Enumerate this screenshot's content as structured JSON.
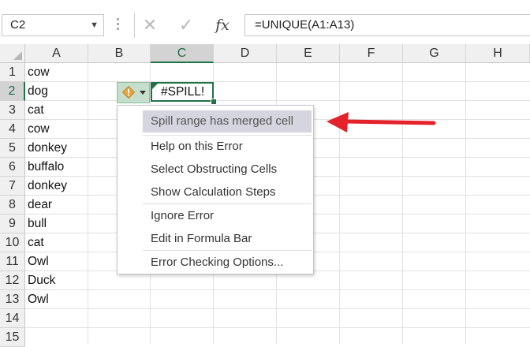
{
  "formula_bar": {
    "name_box": "C2",
    "cancel_glyph": "✕",
    "enter_glyph": "✓",
    "fx_label": "fx",
    "formula": "=UNIQUE(A1:A13)"
  },
  "columns": [
    "A",
    "B",
    "C",
    "D",
    "E",
    "F",
    "G",
    "H"
  ],
  "rows": [
    "1",
    "2",
    "3",
    "4",
    "5",
    "6",
    "7",
    "8",
    "9",
    "10",
    "11",
    "12",
    "13",
    "14",
    "15"
  ],
  "cells_a": [
    "cow",
    "dog",
    "cat",
    "cow",
    "donkey",
    "buffalo",
    "donkey",
    "dear",
    "bull",
    "cat",
    "Owl",
    "Duck",
    "Owl"
  ],
  "active_cell": {
    "ref": "C2",
    "value": "#SPILL!"
  },
  "error_button": {
    "icon": "warning-diamond-icon",
    "accent": "#e8a33a"
  },
  "menu": {
    "title": "Spill range has merged cell",
    "items": [
      "Help on this Error",
      "Select Obstructing Cells",
      "Show Calculation Steps",
      "Ignore Error",
      "Edit in Formula Bar",
      "Error Checking Options..."
    ]
  },
  "colors": {
    "excel_green": "#217346",
    "annotation_red": "#e3222b",
    "menu_highlight": "#d5d5df"
  }
}
